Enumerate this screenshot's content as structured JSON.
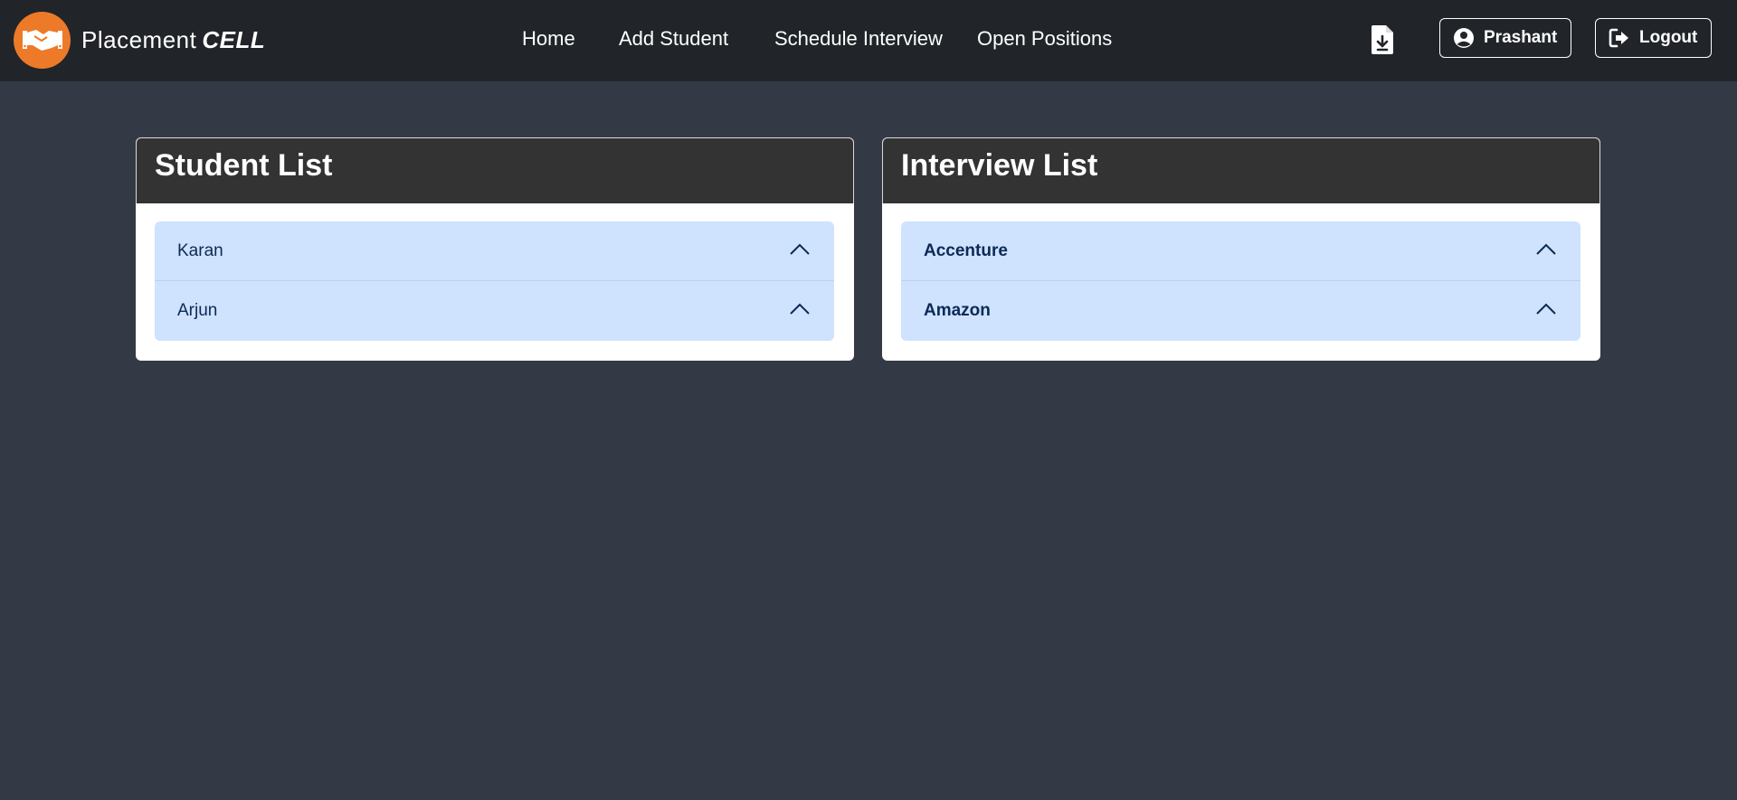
{
  "brand": {
    "name": "Placement",
    "accent": "CELL",
    "logo_color": "#ec7a29"
  },
  "nav": {
    "links": [
      {
        "label": "Home"
      },
      {
        "label": "Add Student"
      },
      {
        "label": "Schedule Interview"
      },
      {
        "label": "Open Positions"
      }
    ],
    "download_icon": "file-download-icon",
    "profile_label": "Prashant",
    "profile_icon": "user-circle-icon",
    "logout_label": "Logout",
    "logout_icon": "sign-out-icon"
  },
  "students": {
    "title": "Student List",
    "items": [
      {
        "name": "Karan"
      },
      {
        "name": "Arjun"
      }
    ]
  },
  "interviews": {
    "title": "Interview List",
    "items": [
      {
        "company": "Accenture"
      },
      {
        "company": "Amazon"
      }
    ]
  },
  "colors": {
    "page_bg": "#343a45",
    "navbar_bg": "#212529",
    "card_header_bg": "#333333",
    "accordion_bg": "#cfe2fe",
    "accordion_text": "#0b2a55"
  }
}
